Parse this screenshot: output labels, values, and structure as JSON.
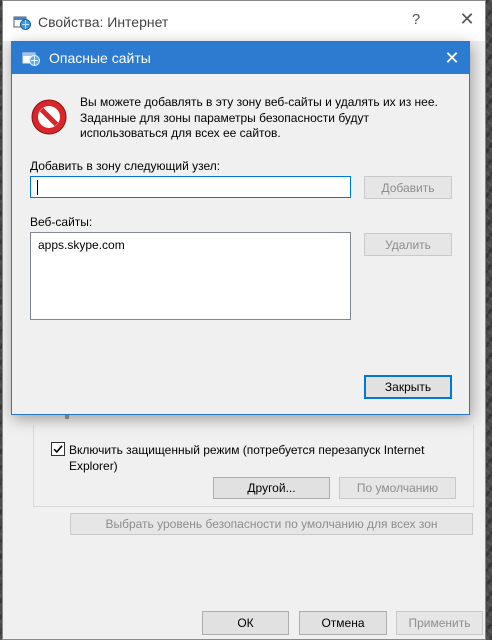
{
  "outer_window": {
    "title": "Свойства: Интернет",
    "help_glyph": "?",
    "close_glyph": "✕",
    "protected_mode": {
      "checked": true,
      "label": "Включить защищенный режим (потребуется перезапуск Internet Explorer)"
    },
    "buttons": {
      "custom": "Другой...",
      "default_level": "По умолчанию",
      "reset_all_zones": "Выбрать уровень безопасности по умолчанию для всех зон",
      "ok": "ОК",
      "cancel": "Отмена",
      "apply": "Применить"
    }
  },
  "dialog": {
    "title": "Опасные сайты",
    "close_glyph": "✕",
    "message": "Вы можете добавлять в эту зону  веб-сайты и удалять их из нее. Заданные для зоны параметры безопасности будут использоваться для всех ее сайтов.",
    "add_label": "Добавить в зону следующий узел:",
    "add_input_value": "",
    "add_button": "Добавить",
    "websites_label": "Веб-сайты:",
    "websites": [
      "apps.skype.com"
    ],
    "remove_button": "Удалить",
    "close_button": "Закрыть"
  },
  "colors": {
    "dialog_titlebar": "#2d7bd1",
    "focus_border": "#0078d7",
    "stop_icon_red": "#d9262b"
  },
  "icons": [
    "internet-options-icon",
    "stop-icon",
    "checkmark-icon",
    "close-icon",
    "help-icon"
  ]
}
